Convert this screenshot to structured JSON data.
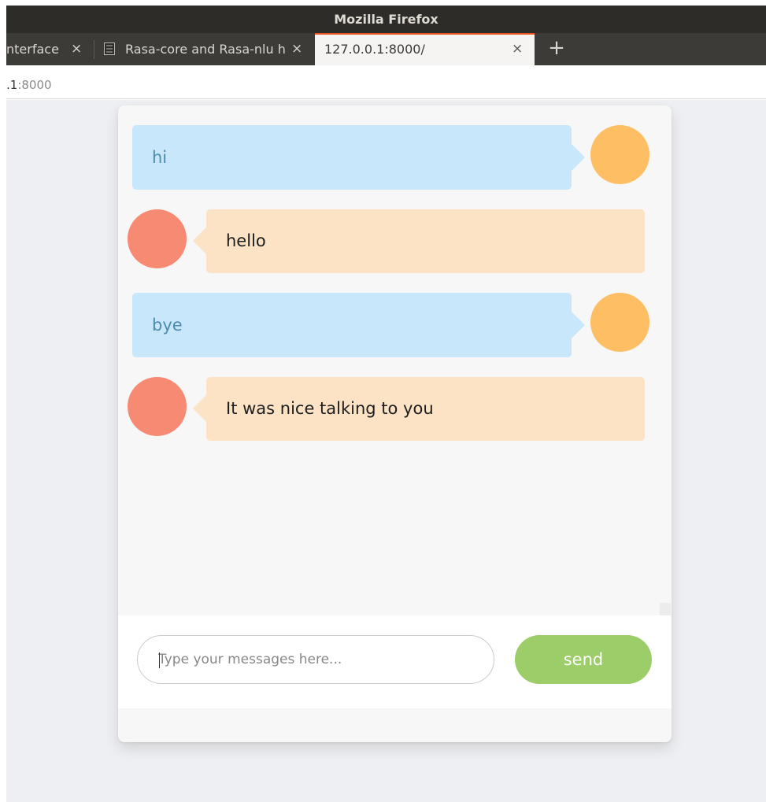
{
  "window": {
    "title": "Mozilla Firefox"
  },
  "tabs": [
    {
      "label": "nterface",
      "active": false
    },
    {
      "label": "Rasa-core and Rasa-nlu h",
      "active": false
    },
    {
      "label": "127.0.0.1:8000/",
      "active": true
    }
  ],
  "tab_close_glyph": "×",
  "new_tab_glyph": "+",
  "address_bar": {
    "prefix": ".1",
    "rest": ":8000"
  },
  "chat": {
    "messages": [
      {
        "sender": "user",
        "text": "hi"
      },
      {
        "sender": "bot",
        "text": "hello"
      },
      {
        "sender": "user",
        "text": "bye"
      },
      {
        "sender": "bot",
        "text": "It was nice talking to you"
      }
    ],
    "input": {
      "value": "",
      "placeholder": "Type your messages here..."
    },
    "send_label": "send"
  },
  "colors": {
    "user_bubble": "#c9e7fa",
    "user_text": "#4b8db0",
    "user_avatar": "#fdbe64",
    "bot_bubble": "#fde3c5",
    "bot_avatar": "#f68a72",
    "send_button": "#9ccd68",
    "tab_accent": "#e95420"
  }
}
